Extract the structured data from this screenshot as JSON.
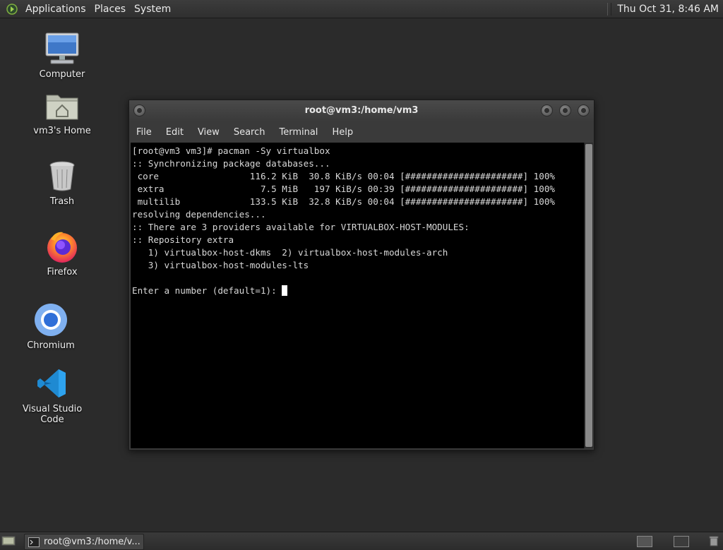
{
  "top_panel": {
    "menus": [
      "Applications",
      "Places",
      "System"
    ],
    "clock": "Thu Oct 31,  8:46 AM"
  },
  "desktop": {
    "icons": [
      {
        "label": "Computer",
        "icon": "computer-icon"
      },
      {
        "label": "vm3's Home",
        "icon": "home-folder-icon"
      },
      {
        "label": "Trash",
        "icon": "trash-icon"
      },
      {
        "label": "Firefox",
        "icon": "firefox-icon"
      },
      {
        "label": "Chromium",
        "icon": "chromium-icon"
      },
      {
        "label": "Visual Studio Code",
        "icon": "vscode-icon"
      }
    ]
  },
  "terminal": {
    "title": "root@vm3:/home/vm3",
    "menu": [
      "File",
      "Edit",
      "View",
      "Search",
      "Terminal",
      "Help"
    ],
    "lines": [
      "[root@vm3 vm3]# pacman -Sy virtualbox",
      ":: Synchronizing package databases...",
      " core                 116.2 KiB  30.8 KiB/s 00:04 [######################] 100%",
      " extra                  7.5 MiB   197 KiB/s 00:39 [######################] 100%",
      " multilib             133.5 KiB  32.8 KiB/s 00:04 [######################] 100%",
      "resolving dependencies...",
      ":: There are 3 providers available for VIRTUALBOX-HOST-MODULES:",
      ":: Repository extra",
      "   1) virtualbox-host-dkms  2) virtualbox-host-modules-arch",
      "   3) virtualbox-host-modules-lts",
      ""
    ],
    "prompt": "Enter a number (default=1): "
  },
  "taskbar": {
    "task_label": "root@vm3:/home/v..."
  }
}
